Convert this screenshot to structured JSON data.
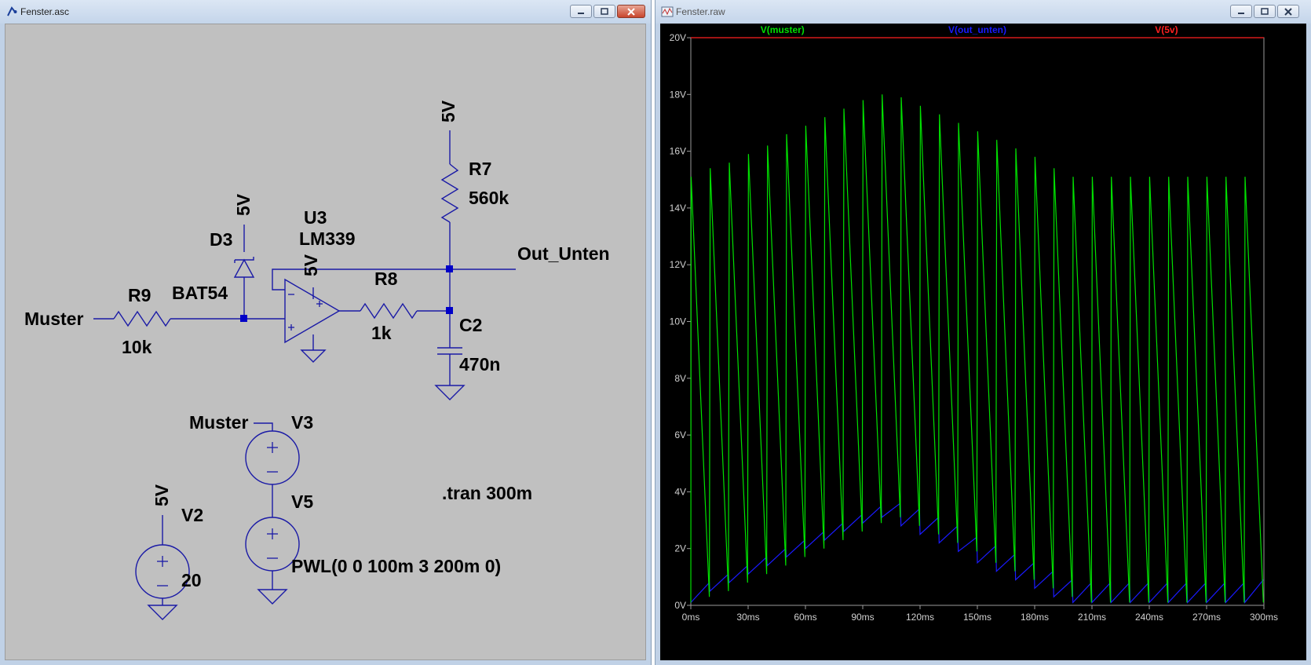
{
  "schematic_window": {
    "title": "Fenster.asc",
    "labels": {
      "net_muster_in": "Muster",
      "r9_name": "R9",
      "r9_value": "10k",
      "d3_name": "D3",
      "d3_value": "BAT54",
      "d3_supply": "5V",
      "u3_name": "U3",
      "u3_value": "LM339",
      "u3_supply": "5V",
      "r8_name": "R8",
      "r8_value": "1k",
      "r7_supply": "5V",
      "r7_name": "R7",
      "r7_value": "560k",
      "out_label": "Out_Unten",
      "c2_name": "C2",
      "c2_value": "470n",
      "v3_net": "Muster",
      "v3_name": "V3",
      "v5_name": "V5",
      "v5_value": "PWL(0 0 100m 3 200m 0)",
      "v2_supply": "5V",
      "v2_name": "V2",
      "v2_value": "20",
      "directive": ".tran 300m"
    }
  },
  "waveform_window": {
    "title": "Fenster.raw",
    "colors": {
      "background": "#000000",
      "axis": "#9a9a9a",
      "muster": "#00e000",
      "out_unten": "#1a1aff",
      "v5v": "#ff2020"
    }
  },
  "chart_data": {
    "type": "line",
    "title": "",
    "xlabel": "",
    "ylabel": "",
    "xlim": [
      0,
      300
    ],
    "ylim": [
      0,
      20
    ],
    "x_unit": "ms",
    "y_unit": "V",
    "x_ticks": [
      "0ms",
      "30ms",
      "60ms",
      "90ms",
      "120ms",
      "150ms",
      "180ms",
      "210ms",
      "240ms",
      "270ms",
      "300ms"
    ],
    "y_ticks": [
      "0V",
      "2V",
      "4V",
      "6V",
      "8V",
      "10V",
      "12V",
      "14V",
      "16V",
      "18V",
      "20V"
    ],
    "series": [
      {
        "name": "V(muster)",
        "color": "#00e000",
        "period_ms": 10,
        "peaks_v": [
          15.1,
          15.4,
          15.6,
          15.9,
          16.2,
          16.6,
          16.9,
          17.2,
          17.5,
          17.8,
          18.0,
          17.9,
          17.6,
          17.3,
          17.0,
          16.7,
          16.4,
          16.1,
          15.8,
          15.4,
          15.1,
          15.1,
          15.1,
          15.1,
          15.1,
          15.1,
          15.1,
          15.1,
          15.1,
          15.1
        ],
        "valleys_v": [
          0.3,
          0.5,
          0.8,
          1.1,
          1.4,
          1.7,
          2.0,
          2.3,
          2.6,
          2.9,
          3.1,
          2.8,
          2.5,
          2.2,
          1.9,
          1.5,
          1.2,
          0.9,
          0.6,
          0.3,
          0.1,
          0.1,
          0.1,
          0.1,
          0.1,
          0.1,
          0.1,
          0.1,
          0.1,
          0.1
        ]
      },
      {
        "name": "V(out_unten)",
        "color": "#1a1aff",
        "period_ms": 10,
        "starts_v": [
          0.1,
          0.5,
          0.8,
          1.1,
          1.4,
          1.7,
          2.0,
          2.3,
          2.6,
          2.9,
          3.1,
          2.8,
          2.5,
          2.2,
          1.9,
          1.5,
          1.2,
          0.9,
          0.6,
          0.3,
          0.1,
          0.1,
          0.1,
          0.1,
          0.1,
          0.1,
          0.1,
          0.1,
          0.1,
          0.1
        ],
        "ends_v": [
          0.8,
          1.1,
          1.4,
          1.7,
          2.0,
          2.3,
          2.6,
          2.9,
          3.2,
          3.5,
          3.6,
          3.4,
          3.1,
          2.8,
          2.4,
          2.1,
          1.8,
          1.5,
          1.2,
          0.9,
          0.8,
          0.8,
          0.8,
          0.8,
          0.8,
          0.8,
          0.8,
          0.8,
          0.8,
          0.9
        ]
      },
      {
        "name": "V(5v)",
        "color": "#ff2020",
        "x": [
          0,
          300
        ],
        "values": [
          20,
          20
        ]
      }
    ]
  }
}
